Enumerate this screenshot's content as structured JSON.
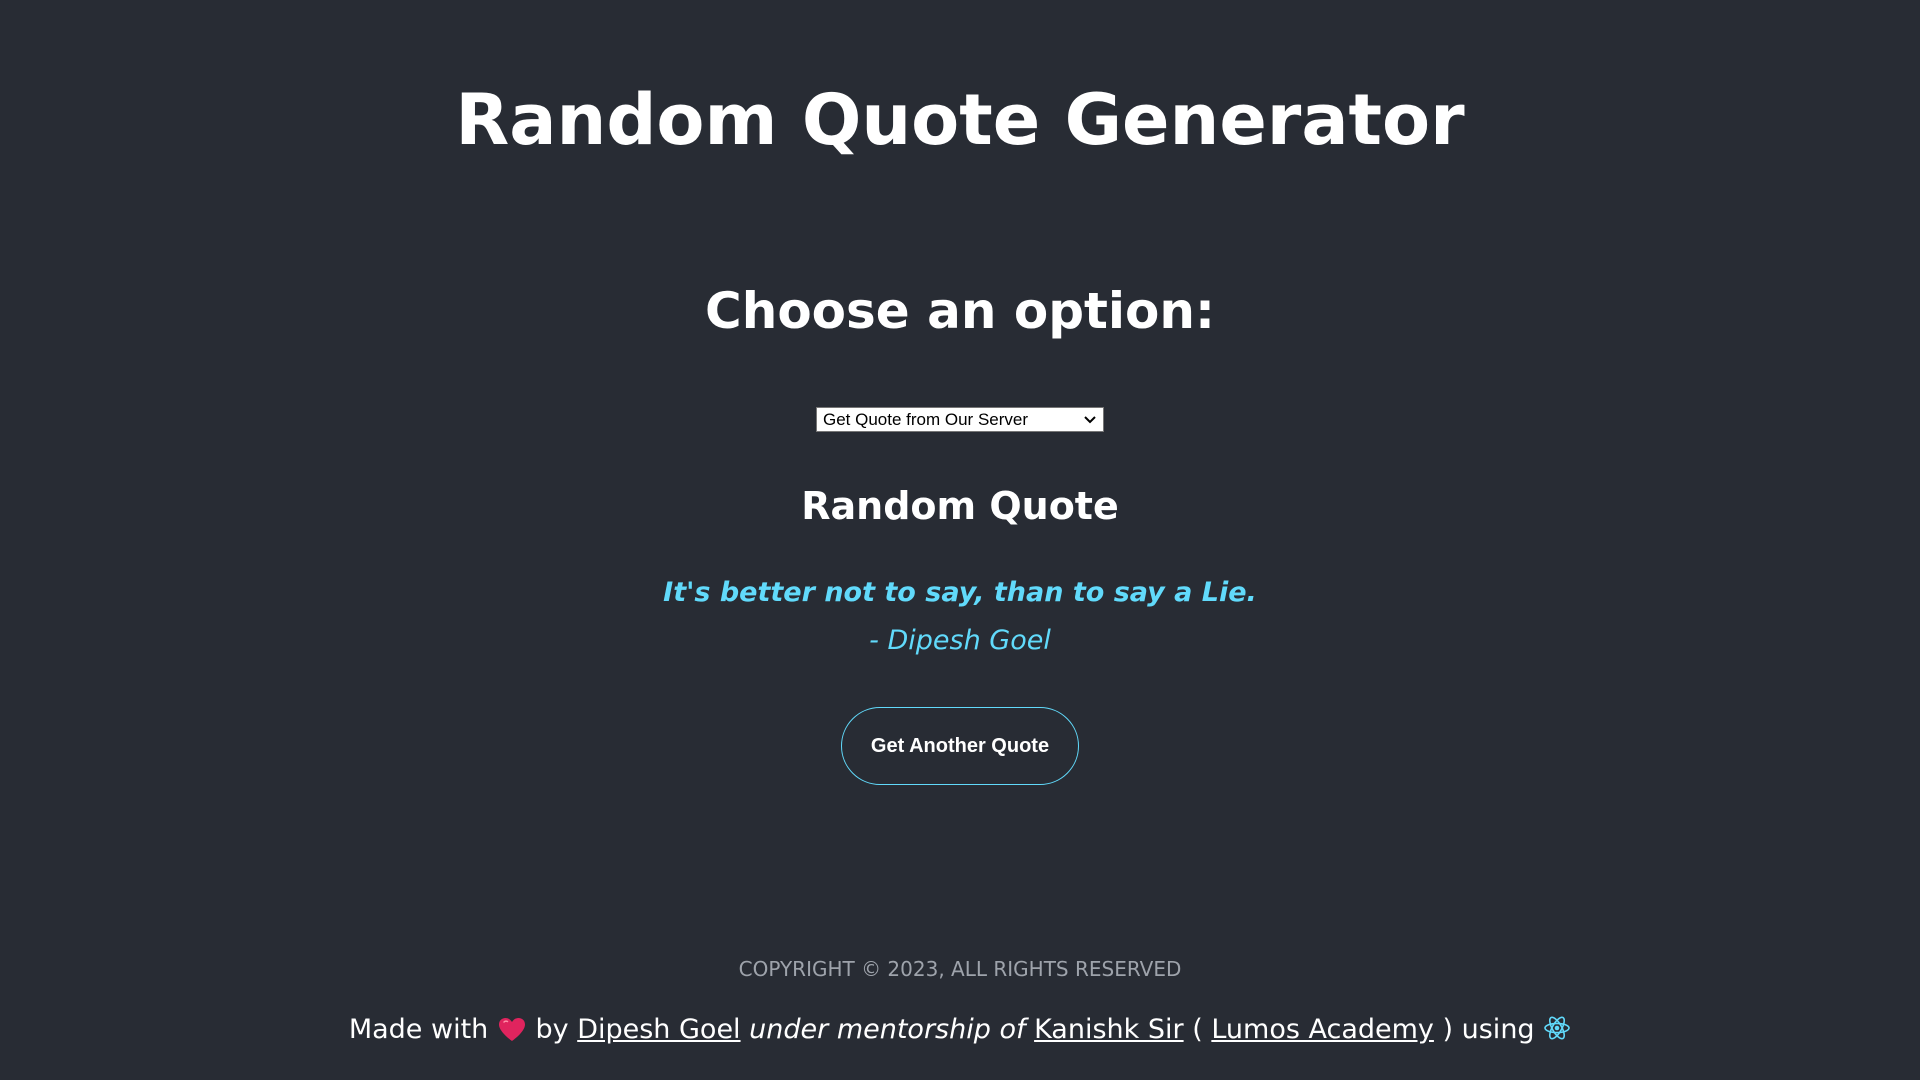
{
  "header": {
    "title": "Random Quote Generator"
  },
  "options": {
    "heading": "Choose an option:",
    "select": {
      "selected": "Get Quote from Our Server"
    }
  },
  "quote": {
    "heading": "Random Quote",
    "text": "It's better not to say, than to say a Lie.",
    "author": "- Dipesh Goel"
  },
  "actions": {
    "another_label": "Get Another Quote"
  },
  "footer": {
    "copyright": "COPYRIGHT © 2023, ALL RIGHTS RESERVED",
    "made_with": "Made with",
    "by": "by",
    "author_link": "Dipesh Goel",
    "under_mentorship": "under mentorship of",
    "mentor_link": "Kanishk Sir",
    "open_paren": "(",
    "academy_link": "Lumos Academy",
    "close_paren_using": ") using",
    "heart_icon": "heart-icon",
    "react_icon": "react-logo-icon"
  },
  "colors": {
    "background": "#282c34",
    "accent": "#61dafb",
    "heart": "#e0245e"
  }
}
